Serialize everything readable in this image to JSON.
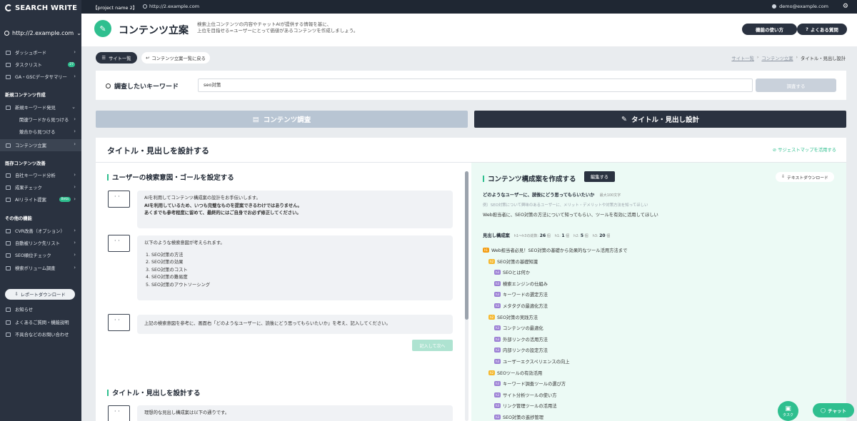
{
  "topbar": {
    "app_name": "SEARCH WRITE",
    "project": "【project name 2】",
    "site_url": "http://2.example.com",
    "user_email": "demo@example.com"
  },
  "sidebar": {
    "site_url": "http://2.example.com",
    "items": [
      {
        "label": "ダッシュボード",
        "icon": "dashboard-icon"
      },
      {
        "label": "タスクリスト",
        "icon": "task-icon",
        "badge": "27"
      },
      {
        "label": "GA・GSCデータサマリー",
        "icon": "chart-icon"
      }
    ],
    "section_new": "新規コンテンツ作成",
    "new_items": [
      {
        "label": "新規キーワード発見"
      },
      {
        "label": "関連ワードから見つける"
      },
      {
        "label": "競合から見つける"
      },
      {
        "label": "コンテンツ立案"
      }
    ],
    "section_existing": "既存コンテンツ改善",
    "existing_items": [
      {
        "label": "自社キーワード分析"
      },
      {
        "label": "成果チェック"
      },
      {
        "label": "AIリライト提案",
        "badge": "Beta"
      }
    ],
    "section_other": "その他の機能",
    "other_items": [
      {
        "label": "CVR改善（オプション）"
      },
      {
        "label": "自動被リンク先リスト"
      },
      {
        "label": "SEO順位チェック"
      },
      {
        "label": "検索ボリューム調査"
      }
    ],
    "report_button": "レポートダウンロード",
    "footer_items": [
      {
        "label": "お知らせ"
      },
      {
        "label": "よくあるご質問・機能説明"
      },
      {
        "label": "不具合などのお問い合わせ"
      }
    ]
  },
  "header": {
    "title": "コンテンツ立案",
    "description_line1": "検索上位コンテンツの内容やチャットAIが提供する情報を基に、",
    "description_line2": "上位を目指せる=ユーザーにとって価値があるコンテンツを作成しましょう。",
    "how_to_button": "機能の使い方",
    "faq_button": "よくある質問"
  },
  "subnav": {
    "site_list": "サイト一覧",
    "back_link": "コンテンツ立案一覧に戻る",
    "breadcrumb": [
      "サイト一覧",
      "コンテンツ立案",
      "タイトル・見出し設計"
    ]
  },
  "search": {
    "label": "調査したいキーワード",
    "value": "seo対策",
    "button": "調査する"
  },
  "tabs": {
    "content_research": "コンテンツ調査",
    "title_design": "タイトル・見出し設計"
  },
  "main": {
    "title": "タイトル・見出しを設計する",
    "suggest_link": "サジェストマップを活用する",
    "left": {
      "section1_title": "ユーザーの検索意図・ゴールを設定する",
      "bubble1_line1": "AIを利用してコンテンツ構成案の設計をお手伝いします。",
      "bubble1_line2": "AIを利用しているため、いつも完璧なものを提案できるわけではありません。",
      "bubble1_line3": "あくまでも参考程度に留めて、最終的にはご自身でお必ず修正してください。",
      "bubble2_intro": "以下のような検索意図が考えられます。",
      "intents": [
        "1. SEO対策の方法",
        "2. SEO対策の効果",
        "3. SEO対策のコスト",
        "4. SEO対策の難易度",
        "5. SEO対策のアウトソーシング"
      ],
      "bubble3": "上記の検索意図を参考に、画面右「どのようなユーザーに、読後にどう思ってもらいたいか」を考え、記入してください。",
      "next_button": "記入して次へ",
      "section2_title": "タイトル・見出しを設計する",
      "bubble4": "理想的な見出し構成案は以下の通りです。"
    },
    "right": {
      "title": "コンテンツ構成案を作成する",
      "edit_button": "編集する",
      "download_button": "テキストダウンロード",
      "question_label": "どのようなユーザーに、読後にどう思ってもらいたいか",
      "question_max": "最大100文字",
      "question_placeholder": "例）SEO対策について興味のあるユーザーに、メリット・デメリットや対策方法を知ってほしい",
      "question_answer": "Web担当者に、SEO対策の方法について知ってもらい、ツールを有効に活用してほしい",
      "headings_label": "見出し構成案",
      "counts_label": "h1〜h3の総数:",
      "total": "26",
      "h1_label": "h1:",
      "h1": "1",
      "h2_label": "h2:",
      "h2": "5",
      "h3_label": "h3:",
      "h3": "20",
      "unit": "個",
      "outline": [
        {
          "level": "h1",
          "text": "Web担当者必見！SEO対策の基礎から効果的なツール活用方法まで"
        },
        {
          "level": "h2",
          "text": "SEO対策の基礎知識"
        },
        {
          "level": "h3",
          "text": "SEOとは何か"
        },
        {
          "level": "h3",
          "text": "検索エンジンの仕組み"
        },
        {
          "level": "h3",
          "text": "キーワードの選定方法"
        },
        {
          "level": "h3",
          "text": "メタタグの最適化方法"
        },
        {
          "level": "h2",
          "text": "SEO対策の実践方法"
        },
        {
          "level": "h3",
          "text": "コンテンツの最適化"
        },
        {
          "level": "h3",
          "text": "外部リンクの活用方法"
        },
        {
          "level": "h3",
          "text": "内部リンクの設定方法"
        },
        {
          "level": "h3",
          "text": "ユーザーエクスペリエンスの向上"
        },
        {
          "level": "h2",
          "text": "SEOツールの有効活用"
        },
        {
          "level": "h3",
          "text": "キーワード調査ツールの選び方"
        },
        {
          "level": "h3",
          "text": "サイト分析ツールの使い方"
        },
        {
          "level": "h3",
          "text": "リンク管理ツールの活用法"
        },
        {
          "level": "h3",
          "text": "SEO対策の進捗管理"
        }
      ]
    }
  },
  "floating": {
    "task_label": "タスク",
    "chat_label": "チャット"
  },
  "colors": {
    "accent": "#2fbf8f",
    "sidebar_bg": "#2a3240",
    "panel_green": "#ecfaf5"
  }
}
